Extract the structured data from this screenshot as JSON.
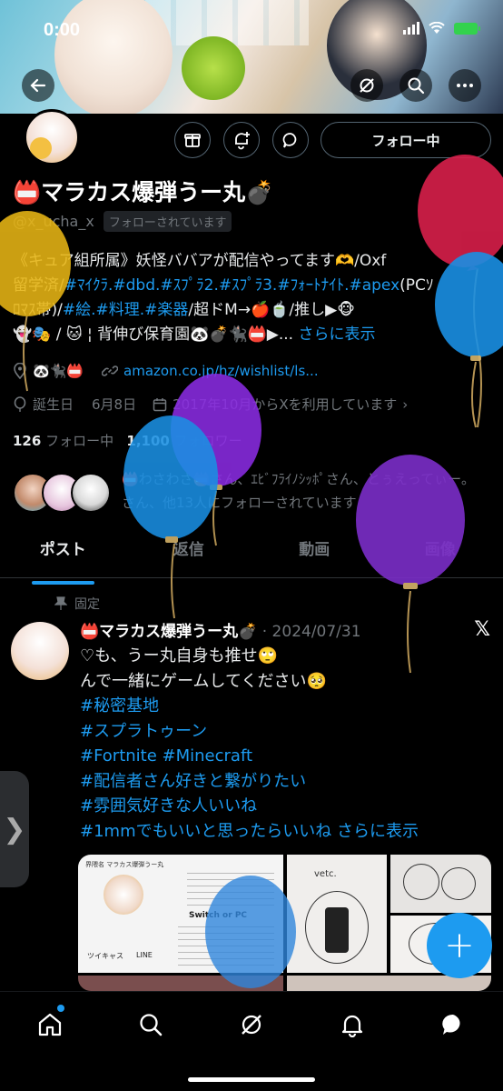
{
  "status_bar": {
    "time": "0:00"
  },
  "profile": {
    "display_name": "📛マラカス爆弾うー丸💣",
    "handle": "@x_ucha_x",
    "follows_you": "フォローされています",
    "follow_button": "フォロー中",
    "bio_lines": [
      {
        "text": "《キュア組所属》妖怪ババアが配信やってます🫶/Oxf"
      },
      {
        "prefix": "留学済/",
        "tags": "#ﾏｲｸﾗ.#dbd.#ｽﾌﾟﾗ2.#ｽﾌﾟﾗ3.#ﾌｫｰﾄﾅｲﾄ.#apex",
        "suffix": "(PCｿ"
      },
      {
        "prefix": "ﾛﾏｽ帯)/",
        "tags": "#絵.#料理.#楽器",
        "suffix": "/超ドM→🍎🍵/推し▶🐵"
      },
      {
        "text": "👻🎭 / 🐱 ¦ 背伸び保育園🐼💣🐈‍⬛📛▶...",
        "more": "さらに表示"
      }
    ],
    "location": "🐼🐈‍⬛📛",
    "link": "amazon.co.jp/hz/wishlist/ls...",
    "birthday_label": "誕生日",
    "birthday": "6月8日",
    "joined": "2017年10月からXを利用しています",
    "following_count": "126",
    "following_label": "フォロー中",
    "followers_count": "1,100",
    "followers_label": "フォロワー",
    "mutuals_text": "📛わさわさ📛さん、ｴﾋﾞﾌﾗｲﾉｼｯﾎﾟさん、とぅえってぃー。さん、他13人にフォローされています"
  },
  "tabs": [
    "ポスト",
    "返信",
    "動画",
    "画像"
  ],
  "pinned_post": {
    "pinned_label": "固定",
    "author": "📛マラカス爆弾うー丸💣",
    "date": "· 2024/07/31",
    "line1": "♡も、うー丸自身も推せ🙄",
    "line2": "んで一緒にゲームしてください🥺",
    "tags": [
      "#秘密基地",
      "#スプラトゥーン",
      "#Fortnite #Minecraft",
      "#配信者さん好きと繋がりたい",
      "#雰囲気好きな人いいね"
    ],
    "last_tag": "#1mmでもいいと思ったらいいね",
    "more": "さらに表示",
    "media_texts": {
      "card_title": "界隈名 マラカス爆弾うー丸",
      "card_platform": "Switch or PC",
      "card_sns1": "ツイキャス",
      "card_sns2": "LINE",
      "sketch_label": "vetc."
    }
  },
  "nav": [
    "home-icon",
    "search-icon",
    "grok-icon",
    "notifications-icon",
    "messages-icon"
  ],
  "colors": {
    "accent": "#1d9bf0",
    "background": "#000000",
    "muted": "#71767b"
  },
  "balloon_colors": [
    "#d81f4a",
    "#e8b615",
    "#1a8fe3",
    "#8a2be2",
    "#7b2ec9",
    "#1a8fe3",
    "#2f86dc"
  ]
}
